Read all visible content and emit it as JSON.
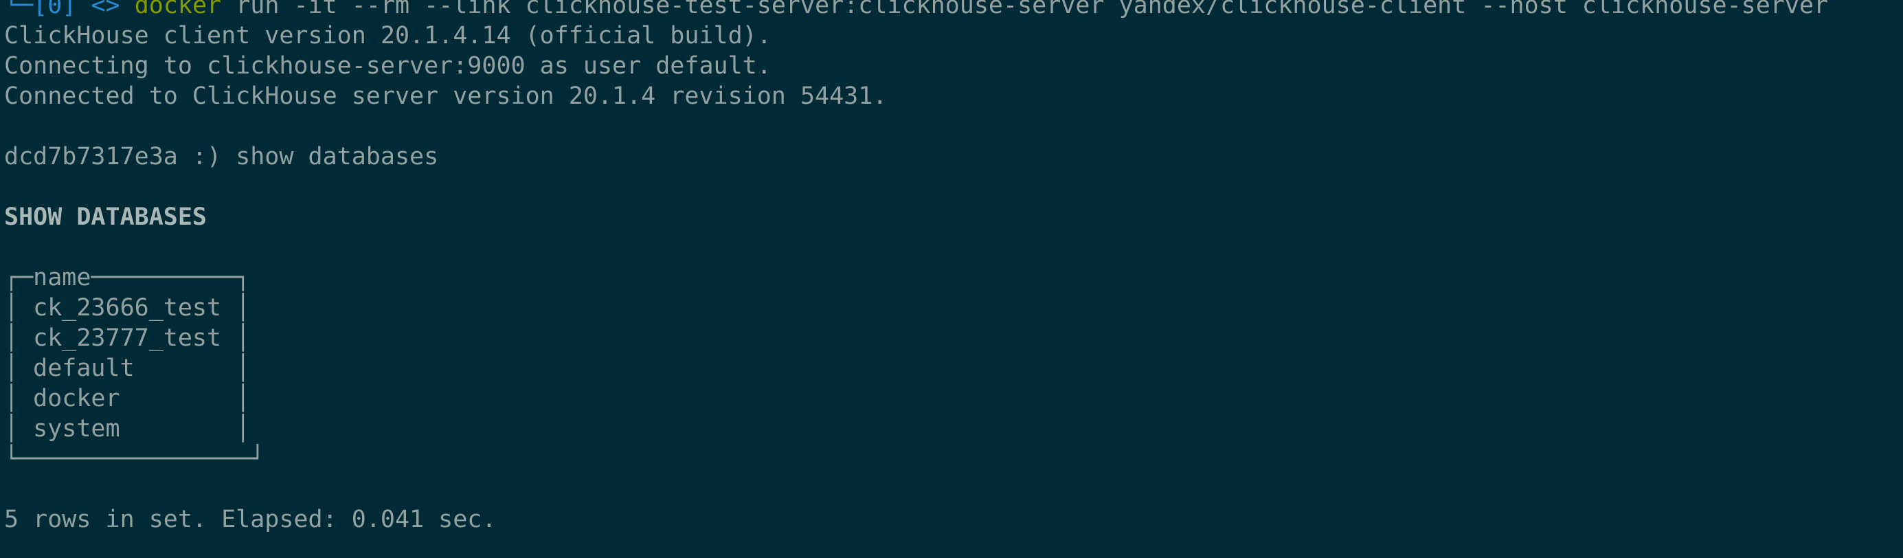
{
  "prompt": {
    "corner": "└─",
    "index": "[0]",
    "arrows": "<>",
    "command": "docker",
    "args": " run -it --rm --link clickhouse-test-server:clickhouse-server yandex/clickhouse-client --host clickhouse-server"
  },
  "output": {
    "client_version": "ClickHouse client version 20.1.4.14 (official build).",
    "connecting": "Connecting to clickhouse-server:9000 as user default.",
    "connected": "Connected to ClickHouse server version 20.1.4 revision 54431.",
    "query_prompt": "dcd7b7317e3a :) ",
    "query": "show databases",
    "query_echo": "SHOW DATABASES",
    "summary": "5 rows in set. Elapsed: 0.041 sec."
  },
  "result_table": {
    "top_left": "┌─",
    "column": "name",
    "top_right": "──────────┐",
    "bottom": "└────────────────┘",
    "rows": [
      {
        "cell": "│ ck_23666_test │"
      },
      {
        "cell": "│ ck_23777_test │"
      },
      {
        "cell": "│ default       │"
      },
      {
        "cell": "│ docker        │"
      },
      {
        "cell": "│ system        │"
      }
    ]
  },
  "colors": {
    "background": "#002b36",
    "text": "#93a1a1",
    "prompt_blue": "#268bd2",
    "command_green": "#859900"
  }
}
